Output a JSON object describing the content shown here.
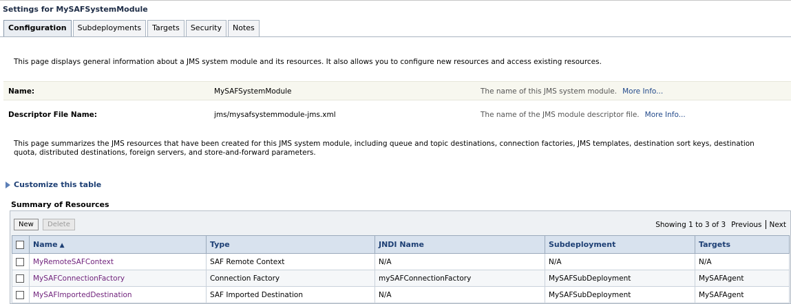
{
  "header": {
    "title": "Settings for MySAFSystemModule"
  },
  "tabs": [
    {
      "label": "Configuration",
      "active": true
    },
    {
      "label": "Subdeployments"
    },
    {
      "label": "Targets"
    },
    {
      "label": "Security"
    },
    {
      "label": "Notes"
    }
  ],
  "intro": "This page displays general information about a JMS system module and its resources. It also allows you to configure new resources and access existing resources.",
  "properties": [
    {
      "label": "Name:",
      "value": "MySAFSystemModule",
      "help": "The name of this JMS system module.",
      "more": "More Info..."
    },
    {
      "label": "Descriptor File Name:",
      "value": "jms/mysafsystemmodule-jms.xml",
      "help": "The name of the JMS module descriptor file.",
      "more": "More Info..."
    }
  ],
  "summary_text": "This page summarizes the JMS resources that have been created for this JMS system module, including queue and topic destinations, connection factories, JMS templates, destination sort keys, destination quota, distributed destinations, foreign servers, and store-and-forward parameters.",
  "customize": "Customize this table",
  "table": {
    "title": "Summary of Resources",
    "new_label": "New",
    "delete_label": "Delete",
    "paging": {
      "showing": "Showing 1 to 3 of 3",
      "previous": "Previous",
      "next": "Next"
    },
    "columns": [
      "Name",
      "Type",
      "JNDI Name",
      "Subdeployment",
      "Targets"
    ],
    "rows": [
      [
        "MyRemoteSAFContext",
        "SAF Remote Context",
        "N/A",
        "N/A",
        "N/A"
      ],
      [
        "MySAFConnectionFactory",
        "Connection Factory",
        "mySAFConnectionFactory",
        "MySAFSubDeployment",
        "MySAFAgent"
      ],
      [
        "MySAFImportedDestination",
        "SAF Imported Destination",
        "N/A",
        "MySAFSubDeployment",
        "MySAFAgent"
      ]
    ]
  }
}
